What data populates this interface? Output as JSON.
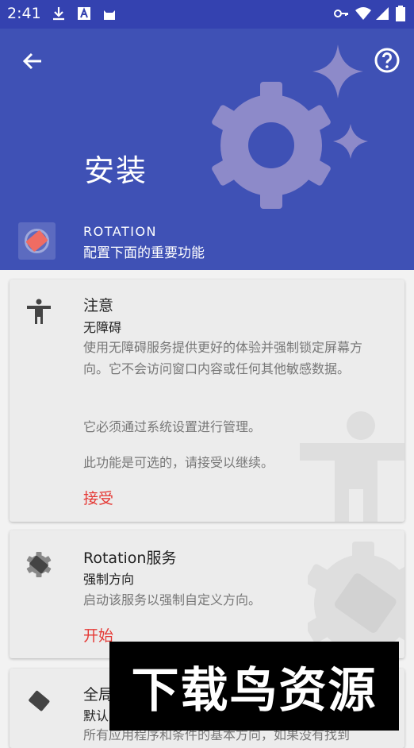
{
  "status_bar": {
    "time": "2:41"
  },
  "header": {
    "title": "安装",
    "app_name": "ROTATION",
    "app_subtitle": "配置下面的重要功能"
  },
  "cards": [
    {
      "title": "注意",
      "subtitle": "无障碍",
      "body": [
        "使用无障碍服务提供更好的体验并强制锁定屏幕方向。它不会访问窗口内容或任何其他敏感数据。",
        "它必须通过系统设置进行管理。",
        "此功能是可选的，请接受以继续。"
      ],
      "action": "接受",
      "icon": "accessibility-icon"
    },
    {
      "title": "Rotation服务",
      "subtitle": "强制方向",
      "body": [
        "启动该服务以强制自定义方向。"
      ],
      "action": "开始",
      "icon": "rotation-service-icon"
    },
    {
      "title": "全局",
      "subtitle": "默认",
      "body": [
        "所有应用程序和条件的基本方向，如果没有找到"
      ],
      "icon": "orientation-icon"
    }
  ],
  "watermark_banner": "下载鸟资源",
  "colors": {
    "primary": "#3f51b5",
    "status_bar": "#3442b0",
    "accent": "#e53935"
  }
}
